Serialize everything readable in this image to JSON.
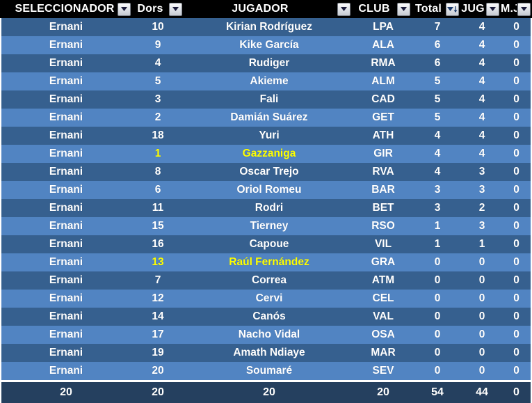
{
  "table": {
    "columns": [
      {
        "key": "seleccionador",
        "label": "SELECCIONADOR",
        "filter_icon": "filter-dropdown-icon"
      },
      {
        "key": "dorsal",
        "label": "Dors",
        "filter_icon": "filter-dropdown-icon"
      },
      {
        "key": "jugador",
        "label": "JUGADOR",
        "filter_icon": "filter-dropdown-icon"
      },
      {
        "key": "club",
        "label": "CLUB",
        "filter_icon": "filter-dropdown-icon"
      },
      {
        "key": "total",
        "label": "Total",
        "filter_icon": "filter-sort-descending-icon"
      },
      {
        "key": "jug",
        "label": "JUG",
        "filter_icon": "filter-dropdown-icon"
      },
      {
        "key": "mj",
        "label": "M.J.",
        "filter_icon": "filter-dropdown-icon"
      }
    ],
    "rows": [
      {
        "seleccionador": "Ernani",
        "dorsal": "10",
        "jugador": "Kirian Rodríguez",
        "club": "LPA",
        "total": "7",
        "jug": "4",
        "mj": "0",
        "highlight": false
      },
      {
        "seleccionador": "Ernani",
        "dorsal": "9",
        "jugador": "Kike García",
        "club": "ALA",
        "total": "6",
        "jug": "4",
        "mj": "0",
        "highlight": false
      },
      {
        "seleccionador": "Ernani",
        "dorsal": "4",
        "jugador": "Rudiger",
        "club": "RMA",
        "total": "6",
        "jug": "4",
        "mj": "0",
        "highlight": false
      },
      {
        "seleccionador": "Ernani",
        "dorsal": "5",
        "jugador": "Akieme",
        "club": "ALM",
        "total": "5",
        "jug": "4",
        "mj": "0",
        "highlight": false
      },
      {
        "seleccionador": "Ernani",
        "dorsal": "3",
        "jugador": "Fali",
        "club": "CAD",
        "total": "5",
        "jug": "4",
        "mj": "0",
        "highlight": false
      },
      {
        "seleccionador": "Ernani",
        "dorsal": "2",
        "jugador": "Damián Suárez",
        "club": "GET",
        "total": "5",
        "jug": "4",
        "mj": "0",
        "highlight": false
      },
      {
        "seleccionador": "Ernani",
        "dorsal": "18",
        "jugador": "Yuri",
        "club": "ATH",
        "total": "4",
        "jug": "4",
        "mj": "0",
        "highlight": false
      },
      {
        "seleccionador": "Ernani",
        "dorsal": "1",
        "jugador": "Gazzaniga",
        "club": "GIR",
        "total": "4",
        "jug": "4",
        "mj": "0",
        "highlight": true
      },
      {
        "seleccionador": "Ernani",
        "dorsal": "8",
        "jugador": "Oscar Trejo",
        "club": "RVA",
        "total": "4",
        "jug": "3",
        "mj": "0",
        "highlight": false
      },
      {
        "seleccionador": "Ernani",
        "dorsal": "6",
        "jugador": "Oriol Romeu",
        "club": "BAR",
        "total": "3",
        "jug": "3",
        "mj": "0",
        "highlight": false
      },
      {
        "seleccionador": "Ernani",
        "dorsal": "11",
        "jugador": "Rodri",
        "club": "BET",
        "total": "3",
        "jug": "2",
        "mj": "0",
        "highlight": false
      },
      {
        "seleccionador": "Ernani",
        "dorsal": "15",
        "jugador": "Tierney",
        "club": "RSO",
        "total": "1",
        "jug": "3",
        "mj": "0",
        "highlight": false
      },
      {
        "seleccionador": "Ernani",
        "dorsal": "16",
        "jugador": "Capoue",
        "club": "VIL",
        "total": "1",
        "jug": "1",
        "mj": "0",
        "highlight": false
      },
      {
        "seleccionador": "Ernani",
        "dorsal": "13",
        "jugador": "Raúl Fernández",
        "club": "GRA",
        "total": "0",
        "jug": "0",
        "mj": "0",
        "highlight": true
      },
      {
        "seleccionador": "Ernani",
        "dorsal": "7",
        "jugador": "Correa",
        "club": "ATM",
        "total": "0",
        "jug": "0",
        "mj": "0",
        "highlight": false
      },
      {
        "seleccionador": "Ernani",
        "dorsal": "12",
        "jugador": "Cervi",
        "club": "CEL",
        "total": "0",
        "jug": "0",
        "mj": "0",
        "highlight": false
      },
      {
        "seleccionador": "Ernani",
        "dorsal": "14",
        "jugador": "Canós",
        "club": "VAL",
        "total": "0",
        "jug": "0",
        "mj": "0",
        "highlight": false
      },
      {
        "seleccionador": "Ernani",
        "dorsal": "17",
        "jugador": "Nacho Vidal",
        "club": "OSA",
        "total": "0",
        "jug": "0",
        "mj": "0",
        "highlight": false
      },
      {
        "seleccionador": "Ernani",
        "dorsal": "19",
        "jugador": "Amath Ndiaye",
        "club": "MAR",
        "total": "0",
        "jug": "0",
        "mj": "0",
        "highlight": false
      },
      {
        "seleccionador": "Ernani",
        "dorsal": "20",
        "jugador": "Soumaré",
        "club": "SEV",
        "total": "0",
        "jug": "0",
        "mj": "0",
        "highlight": false
      }
    ],
    "totals": {
      "seleccionador": "20",
      "dorsal": "20",
      "jugador": "20",
      "club": "20",
      "total": "54",
      "jug": "44",
      "mj": "0"
    }
  },
  "colors": {
    "header_background": "#000000",
    "header_text": "#ffffff",
    "row_odd": "#36608f",
    "row_even": "#5184c2",
    "totals_background": "#25405f",
    "highlight_text": "#ffff00",
    "cell_text": "#ffffff"
  }
}
